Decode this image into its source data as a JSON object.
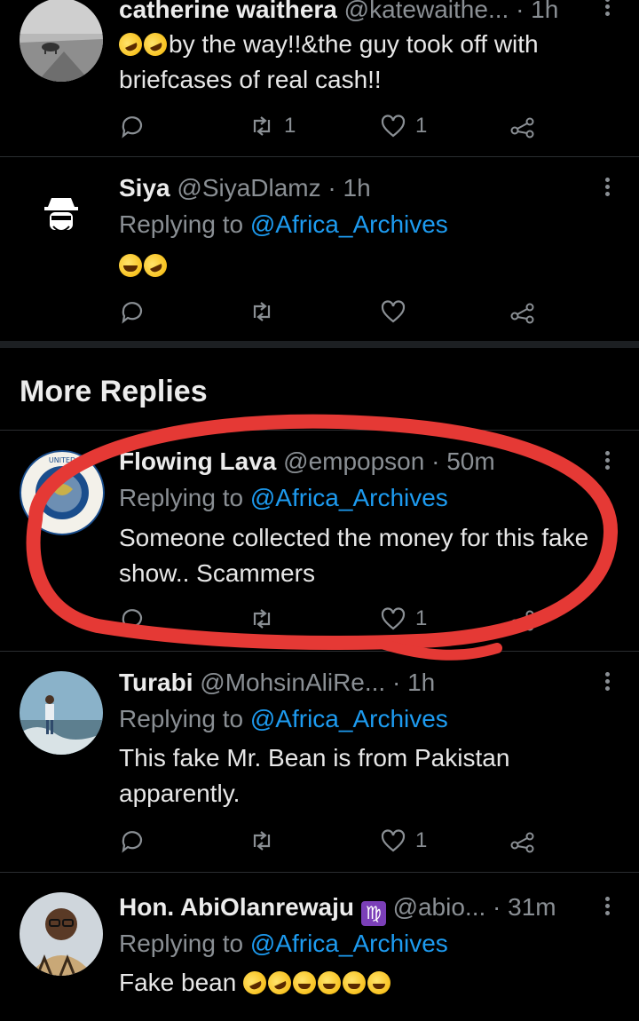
{
  "tweets": [
    {
      "name": "catherine waithera",
      "handle": "@katewaithe...",
      "time": "· 1h",
      "reply_prefix": "",
      "reply_to": "",
      "text": "by the way!!&the guy took off with briefcases of real cash!!",
      "emoji_before": [
        "rofl",
        "rofl"
      ],
      "emoji_after": [],
      "retweets": "1",
      "likes": "1"
    },
    {
      "name": "Siya",
      "handle": "@SiyaDlamz",
      "time": "· 1h",
      "reply_prefix": "Replying to",
      "reply_to": "@Africa_Archives",
      "text": "",
      "emoji_before": [
        "grin",
        "rofl"
      ],
      "emoji_after": [],
      "retweets": "",
      "likes": ""
    },
    {
      "name": "Flowing Lava",
      "handle": "@empopson",
      "time": "· 50m",
      "reply_prefix": "Replying to",
      "reply_to": "@Africa_Archives",
      "text": "Someone collected the money for this fake show.. Scammers",
      "emoji_before": [],
      "emoji_after": [],
      "retweets": "",
      "likes": "1"
    },
    {
      "name": "Turabi",
      "handle": "@MohsinAliRe...",
      "time": "· 1h",
      "reply_prefix": "Replying to",
      "reply_to": "@Africa_Archives",
      "text": "This fake Mr. Bean is from Pakistan apparently.",
      "emoji_before": [],
      "emoji_after": [],
      "retweets": "",
      "likes": "1"
    },
    {
      "name": "Hon. AbiOlanrewaju",
      "badge": "♍",
      "handle": "@abio...",
      "time": "· 31m",
      "reply_prefix": "Replying to",
      "reply_to": "@Africa_Archives",
      "text": "Fake bean",
      "emoji_before": [],
      "emoji_after": [
        "rofl",
        "rofl",
        "joy",
        "joy",
        "joy",
        "joy"
      ],
      "retweets": "",
      "likes": ""
    }
  ],
  "section": {
    "title": "More Replies"
  },
  "colors": {
    "link": "#1d9bf0",
    "muted": "#8a8f94",
    "annotation": "#e53935"
  },
  "icons": [
    "reply-icon",
    "retweet-icon",
    "like-icon",
    "share-icon",
    "more-icon"
  ]
}
